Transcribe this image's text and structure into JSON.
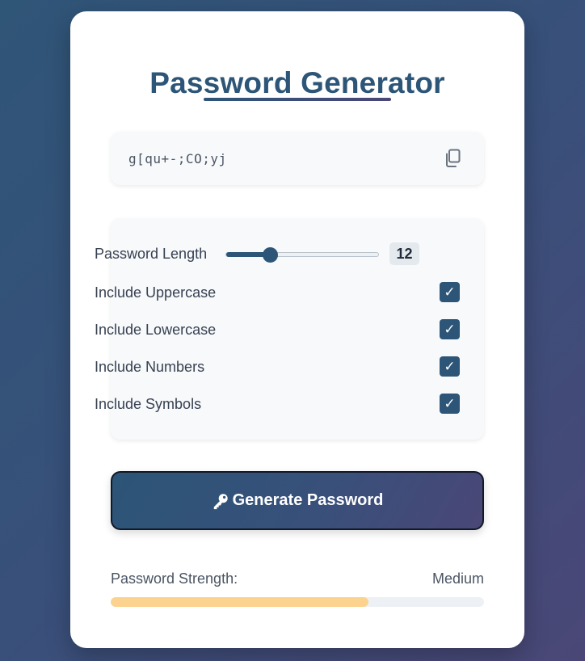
{
  "title": "Password Generator",
  "password": "g[qu+-;CO;yj",
  "icons": {
    "copy": "copy-icon",
    "generate": "key-icon"
  },
  "options": {
    "length": {
      "label": "Password Length",
      "value": "12",
      "min": 4,
      "max": 32
    },
    "uppercase": {
      "label": "Include Uppercase",
      "checked": true
    },
    "lowercase": {
      "label": "Include Lowercase",
      "checked": true
    },
    "numbers": {
      "label": "Include Numbers",
      "checked": true
    },
    "symbols": {
      "label": "Include Symbols",
      "checked": true
    }
  },
  "generate_label": "Generate Password",
  "strength": {
    "label": "Password Strength:",
    "value": "Medium",
    "fraction": 0.69
  },
  "colors": {
    "primary": "#2c5577",
    "accent": "#4a4777",
    "strength_medium": "#fcd38e"
  }
}
